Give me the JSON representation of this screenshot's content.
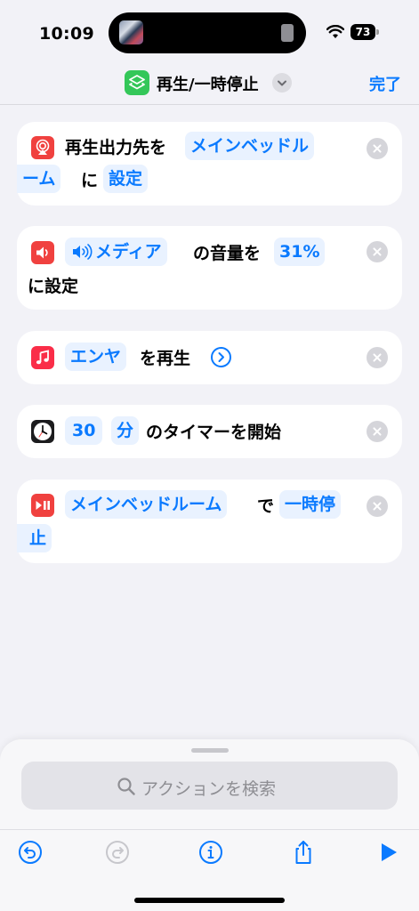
{
  "status_bar": {
    "time": "10:09",
    "battery": "73"
  },
  "nav": {
    "title": "再生/一時停止",
    "done_label": "完了"
  },
  "actions": {
    "a1": {
      "text1": "再生出力先を",
      "token1_line1": "メインベッドル",
      "token1_line2": "ーム",
      "text2": "に",
      "token2": "設定"
    },
    "a2": {
      "token1": "メディア",
      "text1": "の音量を",
      "token2": "31%",
      "text2": "に設定"
    },
    "a3": {
      "token1": "エンヤ",
      "text1": "を再生"
    },
    "a4": {
      "token1": "30",
      "token2": "分",
      "text1": "のタイマーを開始"
    },
    "a5": {
      "token1": "メインベッドルーム",
      "text1": "で",
      "token2_line1": "一時停",
      "token2_line2": "止"
    }
  },
  "search": {
    "placeholder": "アクションを検索"
  },
  "icons": {
    "shortcut": "shortcuts-layers-icon",
    "airplay": "airplay-icon",
    "speaker": "speaker-icon",
    "music": "music-note-icon",
    "clock": "clock-icon",
    "play_pause": "play-pause-icon",
    "toolbar": [
      "undo-icon",
      "redo-icon",
      "info-icon",
      "share-icon",
      "play-icon"
    ]
  },
  "colors": {
    "accent": "#0a7aff",
    "shortcut_green": "#34c759",
    "red": "#f0413f",
    "music_red": "#fa2d48"
  }
}
